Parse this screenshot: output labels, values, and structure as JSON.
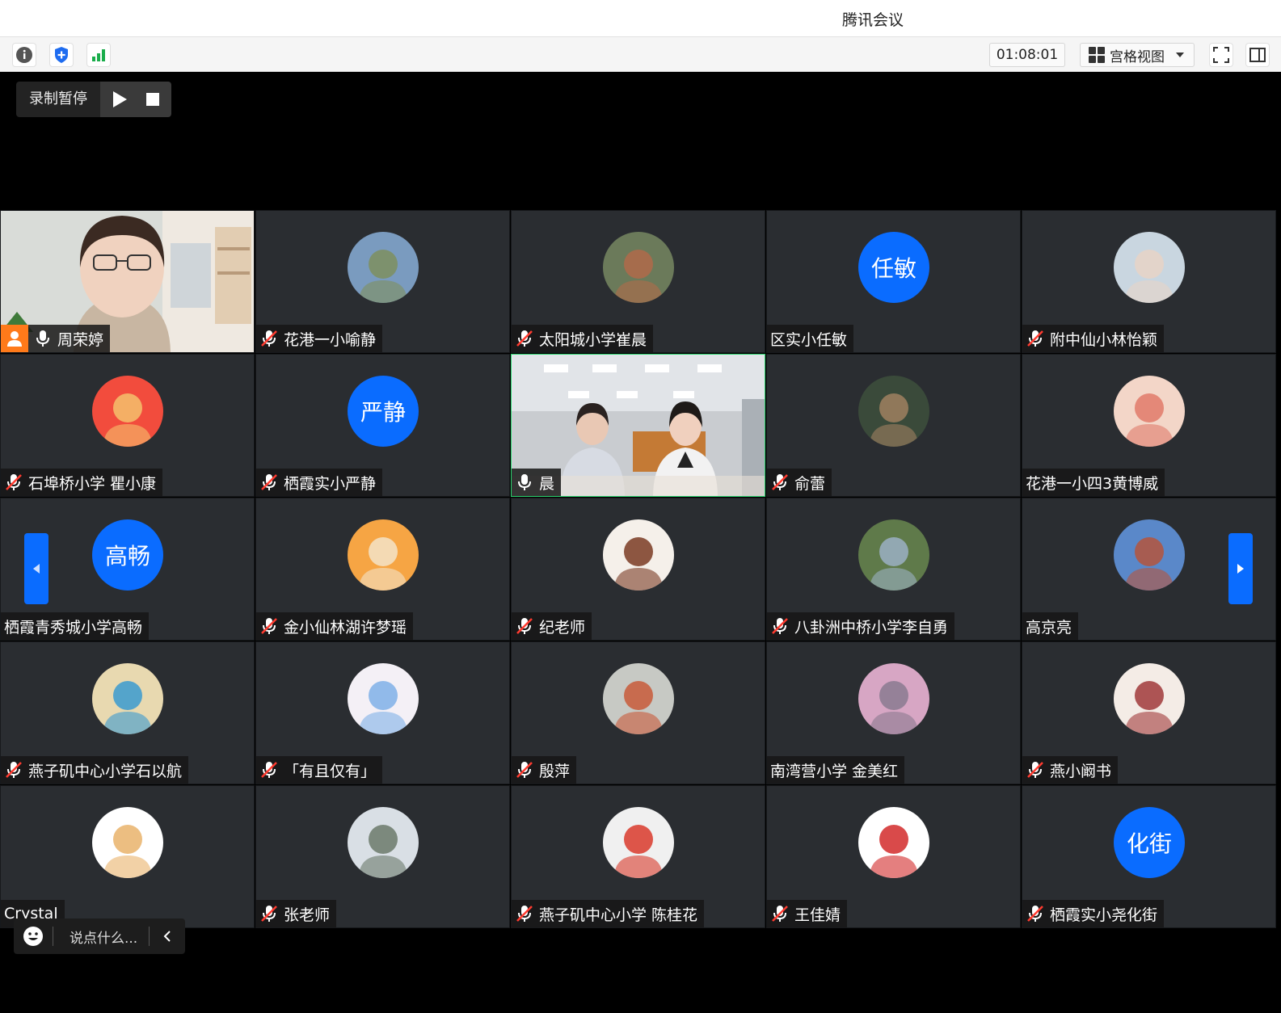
{
  "window": {
    "title": "腾讯会议"
  },
  "toolbar": {
    "timer": "01:08:01",
    "view_label": "宫格视图",
    "icons": [
      "info-icon",
      "security-shield-icon",
      "signal-icon",
      "fullscreen-icon",
      "sidebar-toggle-icon"
    ]
  },
  "recording": {
    "status_label": "录制暂停"
  },
  "participants": [
    {
      "name": "周荣婷",
      "mic": "on",
      "host": true,
      "video": true
    },
    {
      "name": "花港一小喻静",
      "mic": "muted",
      "avatar_colors": [
        "#7a9bbf",
        "#7e8f5e"
      ]
    },
    {
      "name": "太阳城小学崔晨",
      "mic": "muted",
      "avatar_colors": [
        "#6b7a5a",
        "#b06a4a"
      ]
    },
    {
      "name": "区实小任敏",
      "mic": "none",
      "avatar_text": "任敏"
    },
    {
      "name": "附中仙小林怡颖",
      "mic": "muted",
      "avatar_colors": [
        "#c9d6e0",
        "#e8d4c6"
      ]
    },
    {
      "name": "石埠桥小学 瞿小康",
      "mic": "muted",
      "avatar_colors": [
        "#f24c3d",
        "#f5c16c"
      ]
    },
    {
      "name": "栖霞实小严静",
      "mic": "muted",
      "avatar_text": "严静"
    },
    {
      "name": "晨",
      "mic": "on",
      "video": true,
      "active": true
    },
    {
      "name": "俞蕾",
      "mic": "muted",
      "avatar_colors": [
        "#3a4a3a",
        "#a08060"
      ]
    },
    {
      "name": "花港一小四3黄博威",
      "mic": "none",
      "avatar_colors": [
        "#f3d6c8",
        "#e07a6a"
      ]
    },
    {
      "name": "栖霞青秀城小学高畅",
      "mic": "none",
      "avatar_text": "高畅"
    },
    {
      "name": "金小仙林湖许梦瑶",
      "mic": "muted",
      "avatar_colors": [
        "#f6a544",
        "#f3e3c8"
      ]
    },
    {
      "name": "纪老师",
      "mic": "muted",
      "avatar_colors": [
        "#f5f0ea",
        "#7a3b23"
      ]
    },
    {
      "name": "八卦洲中桥小学李自勇",
      "mic": "muted",
      "avatar_colors": [
        "#5f7a4a",
        "#9bb0c4"
      ]
    },
    {
      "name": "高京亮",
      "mic": "none",
      "avatar_colors": [
        "#5a88c9",
        "#b5553c"
      ]
    },
    {
      "name": "燕子矶中心小学石以航",
      "mic": "muted",
      "avatar_colors": [
        "#e8d9b0",
        "#3a9ad0"
      ]
    },
    {
      "name": "「有且仅有」",
      "mic": "muted",
      "avatar_colors": [
        "#f4f0f6",
        "#7fb0e8"
      ]
    },
    {
      "name": "殷萍",
      "mic": "muted",
      "avatar_colors": [
        "#c7c9c4",
        "#c85a3a"
      ]
    },
    {
      "name": "南湾营小学 金美红",
      "mic": "none",
      "avatar_colors": [
        "#d7a6c4",
        "#8a7a90"
      ]
    },
    {
      "name": "燕小阚书",
      "mic": "muted",
      "avatar_colors": [
        "#f4ece6",
        "#a03a3a"
      ]
    },
    {
      "name": "Crystal",
      "mic": "none",
      "avatar_colors": [
        "#ffffff",
        "#e9b36b"
      ]
    },
    {
      "name": "张老师",
      "mic": "muted",
      "avatar_colors": [
        "#d9dfe5",
        "#6b7a6b"
      ]
    },
    {
      "name": "燕子矶中心小学 陈桂花",
      "mic": "muted",
      "avatar_colors": [
        "#f0f0f0",
        "#d93a2b"
      ]
    },
    {
      "name": "王佳婧",
      "mic": "muted",
      "avatar_colors": [
        "#ffffff",
        "#d22a2a"
      ]
    },
    {
      "name": "栖霞实小尧化街",
      "mic": "muted",
      "avatar_text": "化街"
    }
  ],
  "chat": {
    "placeholder": "说点什么..."
  },
  "colors": {
    "accent": "#0a6cff",
    "tile_bg": "#2a2d31",
    "active_border": "#2bd36e",
    "host_badge": "#ff7a1a"
  }
}
